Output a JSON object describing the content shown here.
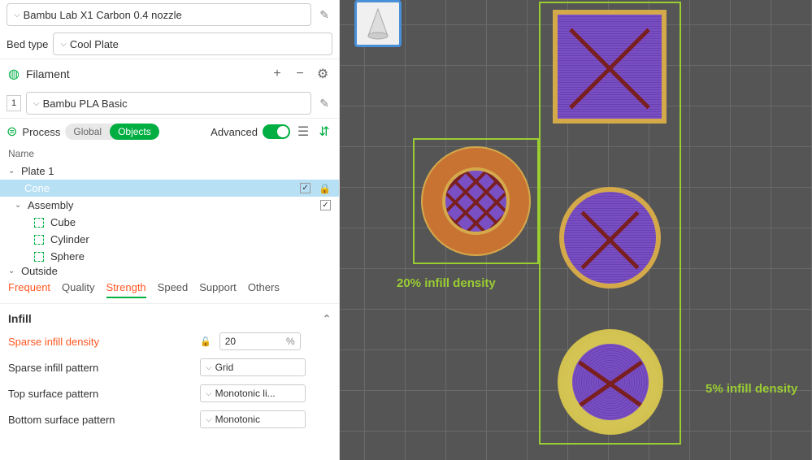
{
  "printer": {
    "name": "Bambu Lab X1 Carbon 0.4 nozzle"
  },
  "bed": {
    "label": "Bed type",
    "value": "Cool Plate"
  },
  "filament": {
    "title": "Filament",
    "slot": "1",
    "value": "Bambu PLA Basic"
  },
  "process": {
    "title": "Process",
    "scope_global": "Global",
    "scope_objects": "Objects",
    "advanced_label": "Advanced"
  },
  "tree": {
    "name_header": "Name",
    "items": [
      {
        "label": "Plate 1",
        "depth": 0,
        "expanded": true
      },
      {
        "label": "Cone",
        "depth": 1,
        "selected": true,
        "checked": true,
        "locked": true
      },
      {
        "label": "Assembly",
        "depth": 1,
        "expanded": true,
        "checked": true
      },
      {
        "label": "Cube",
        "depth": 2,
        "leaf": true
      },
      {
        "label": "Cylinder",
        "depth": 2,
        "leaf": true
      },
      {
        "label": "Sphere",
        "depth": 2,
        "leaf": true
      },
      {
        "label": "Outside",
        "depth": 0,
        "expanded": true,
        "cut": true
      }
    ]
  },
  "tabs": {
    "items": [
      "Frequent",
      "Quality",
      "Strength",
      "Speed",
      "Support",
      "Others"
    ],
    "active": "Strength"
  },
  "settings": {
    "section": "Infill",
    "rows": [
      {
        "label": "Sparse infill density",
        "modified": true,
        "value": "20",
        "unit": "%",
        "type": "number"
      },
      {
        "label": "Sparse infill pattern",
        "value": "Grid",
        "type": "select"
      },
      {
        "label": "Top surface pattern",
        "value": "Monotonic li...",
        "type": "select"
      },
      {
        "label": "Bottom surface pattern",
        "value": "Monotonic",
        "type": "select"
      }
    ]
  },
  "annotations": {
    "left": "20% infill density",
    "right": "5% infill density"
  }
}
